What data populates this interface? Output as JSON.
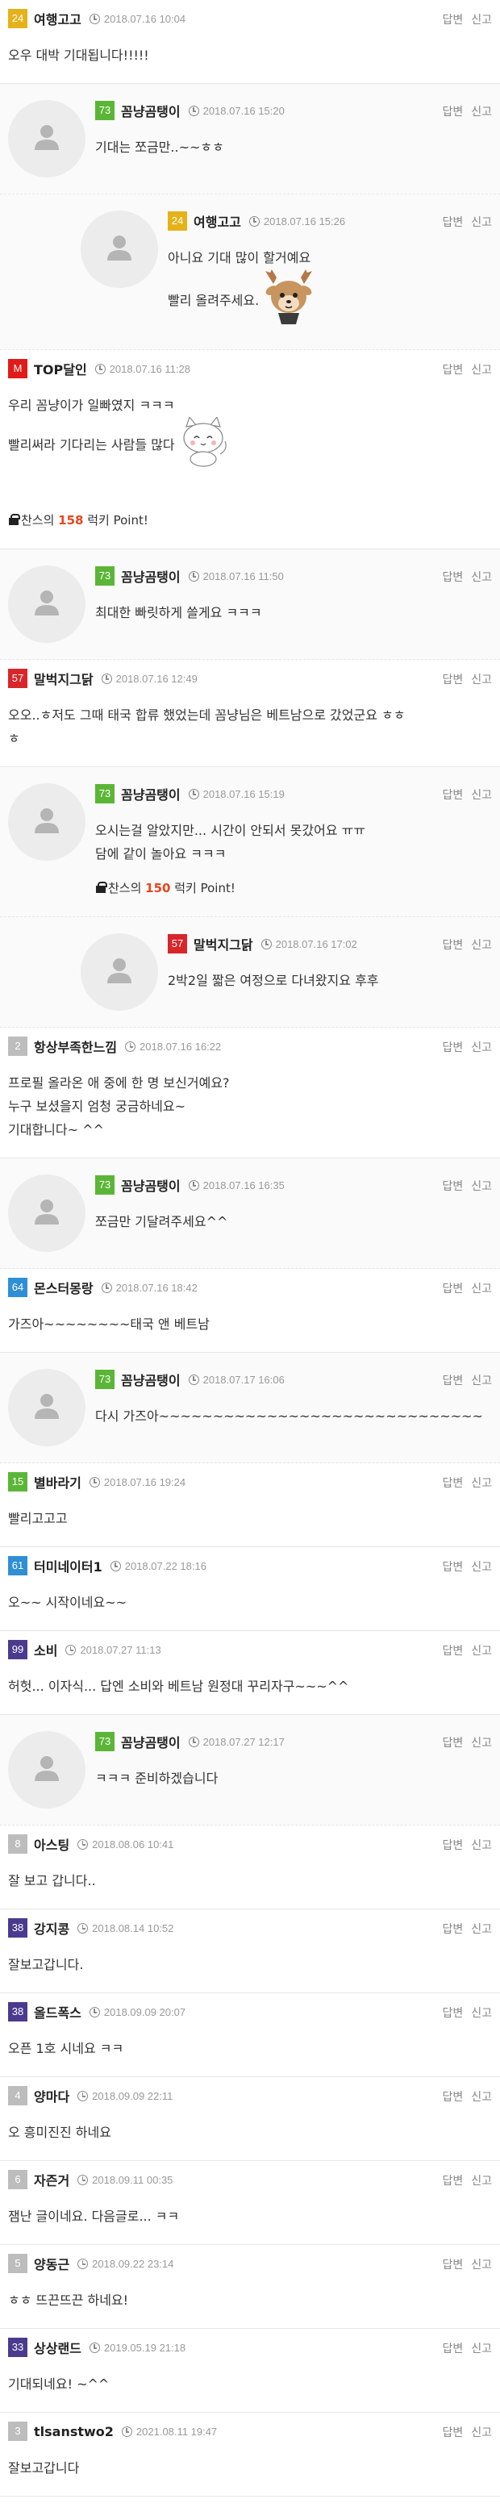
{
  "actions": {
    "reply": "답변",
    "report": "신고"
  },
  "comments": [
    {
      "level": "24",
      "level_color": "#e6b21a",
      "nick": "여행고고",
      "date": "2018.07.16 10:04",
      "lines": [
        "오우 대박 기대됩니다!!!!!"
      ]
    },
    {
      "reply": 1,
      "level": "73",
      "level_color": "#5bb637",
      "nick": "꼼냥곰탱이",
      "date": "2018.07.16 15:20",
      "lines": [
        "기대는 쪼금만..~~ㅎㅎ"
      ]
    },
    {
      "reply": 2,
      "level": "24",
      "level_color": "#e6b21a",
      "nick": "여행고고",
      "date": "2018.07.16 15:26",
      "lines": [
        "아니요 기대 많이 할거예요",
        "빨리 올려주세요."
      ],
      "emoticon": "deer"
    },
    {
      "level": "M",
      "level_color": "#e11a1a",
      "nick": "TOP달인",
      "date": "2018.07.16 11:28",
      "lines": [
        "우리 꼼냥이가 일빠였지 ㅋㅋㅋ",
        "빨리써라 기다리는 사람들 많다",
        ""
      ],
      "emoticon": "cat",
      "lucky": {
        "prefix": "찬스의 ",
        "points": "158",
        "suffix": " 럭키 Point!"
      }
    },
    {
      "reply": 1,
      "level": "73",
      "level_color": "#5bb637",
      "nick": "꼼냥곰탱이",
      "date": "2018.07.16 11:50",
      "lines": [
        "최대한 빠릿하게 쓸게요 ㅋㅋㅋ"
      ]
    },
    {
      "level": "57",
      "level_color": "#d8262b",
      "nick": "말벅지그닭",
      "date": "2018.07.16 12:49",
      "lines": [
        "오오..ㅎ저도 그때 태국 합류 했었는데 꼼냥님은 베트남으로 갔었군요 ㅎㅎ",
        "ㅎ"
      ]
    },
    {
      "reply": 1,
      "level": "73",
      "level_color": "#5bb637",
      "nick": "꼼냥곰탱이",
      "date": "2018.07.16 15:19",
      "lines": [
        "오시는걸 알았지만... 시간이 안되서 못갔어요 ㅠㅠ",
        "담에 같이 놀아요 ㅋㅋㅋ"
      ],
      "lucky": {
        "prefix": "찬스의 ",
        "points": "150",
        "suffix": " 럭키 Point!"
      }
    },
    {
      "reply": 2,
      "level": "57",
      "level_color": "#d8262b",
      "nick": "말벅지그닭",
      "date": "2018.07.16 17:02",
      "lines": [
        "2박2일 짧은 여정으로 다녀왔지요 후후"
      ]
    },
    {
      "level": "2",
      "level_color": "#bdbdbd",
      "nick": "항상부족한느낌",
      "date": "2018.07.16 16:22",
      "lines": [
        "프로필 올라온 애 중에 한 명 보신거예요?",
        "누구 보셨을지 엄청 궁금하네요~",
        "기대합니다~ ^^"
      ]
    },
    {
      "reply": 1,
      "level": "73",
      "level_color": "#5bb637",
      "nick": "꼼냥곰탱이",
      "date": "2018.07.16 16:35",
      "lines": [
        "쪼금만 기달려주세요^^"
      ]
    },
    {
      "level": "64",
      "level_color": "#2f8fd6",
      "nick": "몬스터몽랑",
      "date": "2018.07.16 18:42",
      "lines": [
        "가즈아~~~~~~~~태국 앤 베트남"
      ]
    },
    {
      "reply": 1,
      "level": "73",
      "level_color": "#5bb637",
      "nick": "꼼냥곰탱이",
      "date": "2018.07.17 16:06",
      "lines": [
        "다시 가즈아~~~~~~~~~~~~~~~~~~~~~~~~~~~~~~"
      ]
    },
    {
      "level": "15",
      "level_color": "#5bb637",
      "nick": "별바라기",
      "date": "2018.07.16 19:24",
      "lines": [
        "빨리고고고"
      ]
    },
    {
      "level": "61",
      "level_color": "#2f8fd6",
      "nick": "터미네이터1",
      "date": "2018.07.22 18:16",
      "lines": [
        "오~~ 시작이네요~~"
      ]
    },
    {
      "level": "99",
      "level_color": "#4a3b8f",
      "nick": "소비",
      "date": "2018.07.27 11:13",
      "lines": [
        "허헛... 이자식... 답엔 소비와 베트남 원정대 꾸리자구~~~^^"
      ]
    },
    {
      "reply": 1,
      "level": "73",
      "level_color": "#5bb637",
      "nick": "꼼냥곰탱이",
      "date": "2018.07.27 12:17",
      "lines": [
        "ㅋㅋㅋ 준비하겠습니다"
      ]
    },
    {
      "level": "8",
      "level_color": "#bdbdbd",
      "nick": "아스팅",
      "date": "2018.08.06 10:41",
      "lines": [
        "잘 보고 갑니다.."
      ]
    },
    {
      "level": "38",
      "level_color": "#4a3b8f",
      "nick": "강지콩",
      "date": "2018.08.14 10:52",
      "lines": [
        "잘보고갑니다."
      ]
    },
    {
      "level": "38",
      "level_color": "#4a3b8f",
      "nick": "올드폭스",
      "date": "2018.09.09 20:07",
      "lines": [
        "오픈 1호 시네요 ㅋㅋ"
      ]
    },
    {
      "level": "4",
      "level_color": "#bdbdbd",
      "nick": "양마다",
      "date": "2018.09.09 22:11",
      "lines": [
        "오 흥미진진 하네요"
      ]
    },
    {
      "level": "6",
      "level_color": "#bdbdbd",
      "nick": "자즌거",
      "date": "2018.09.11 00:35",
      "lines": [
        "잼난 글이네요. 다음글로... ㅋㅋ"
      ]
    },
    {
      "level": "5",
      "level_color": "#bdbdbd",
      "nick": "양동근",
      "date": "2018.09.22 23:14",
      "lines": [
        "ㅎㅎ 뜨끈뜨끈 하네요!"
      ]
    },
    {
      "level": "33",
      "level_color": "#4a3b8f",
      "nick": "상상랜드",
      "date": "2019.05.19 21:18",
      "lines": [
        "기대되네요! ~^^"
      ]
    },
    {
      "level": "3",
      "level_color": "#bdbdbd",
      "nick": "tlsanstwo2",
      "date": "2021.08.11 19:47",
      "lines": [
        "잘보고갑니다"
      ]
    }
  ]
}
